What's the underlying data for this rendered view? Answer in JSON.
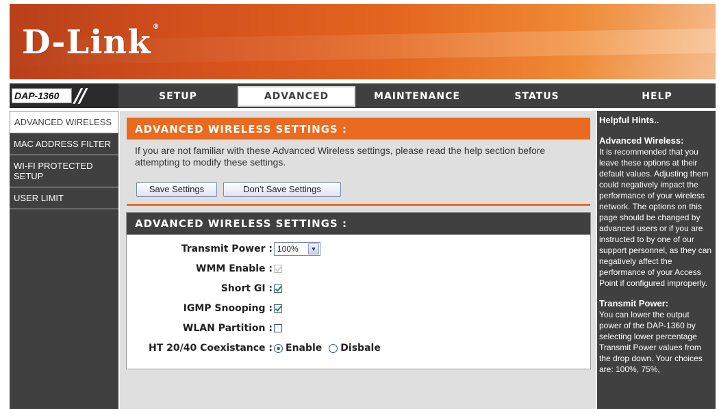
{
  "brand": {
    "logo": "D-Link",
    "reg": "®"
  },
  "nav": {
    "model": "DAP-1360",
    "tabs": [
      "SETUP",
      "ADVANCED",
      "MAINTENANCE",
      "STATUS",
      "HELP"
    ],
    "active_tab": "ADVANCED"
  },
  "sidebar": {
    "items": [
      {
        "label": "ADVANCED WIRELESS",
        "active": true
      },
      {
        "label": "MAC ADDRESS FILTER",
        "active": false
      },
      {
        "label": "WI-FI PROTECTED SETUP",
        "active": false
      },
      {
        "label": "USER LIMIT",
        "active": false
      }
    ]
  },
  "intro": {
    "title": "ADVANCED WIRELESS SETTINGS :",
    "description": "If you are not familiar with these Advanced Wireless settings, please read the help section before attempting to modify these settings.",
    "save_label": "Save Settings",
    "dont_save_label": "Don't Save Settings"
  },
  "settings": {
    "title": "ADVANCED WIRELESS SETTINGS :",
    "transmit_power": {
      "label": "Transmit Power :",
      "value": "100%"
    },
    "wmm_enable": {
      "label": "WMM Enable :",
      "checked": true,
      "disabled": true
    },
    "short_gi": {
      "label": "Short GI :",
      "checked": true
    },
    "igmp_snooping": {
      "label": "IGMP Snooping :",
      "checked": true
    },
    "wlan_partition": {
      "label": "WLAN Partition :",
      "checked": false
    },
    "ht_coexistance": {
      "label": "HT 20/40 Coexistance :",
      "enable_label": "Enable",
      "disable_label": "Disbale",
      "selected": "Enable"
    }
  },
  "help": {
    "title": "Helpful Hints..",
    "section1_title": "Advanced Wireless:",
    "section1_text": "It is recommended that you leave these options at their default values. Adjusting them could negatively impact the performance of your wireless network. The options on this page should be changed by advanced users or if you are instructed to by one of our support personnel, as they can negatively affect the performance of your Access Point if configured improperly.",
    "section2_title": "Transmit Power:",
    "section2_text": "You can lower the output power of the DAP-1360 by selecting lower percentage Transmit Power values from the drop down. Your choices are: 100%, 75%,"
  },
  "colors": {
    "accent": "#ea6b1f",
    "dark": "#404040",
    "panel": "#dfdfdf"
  }
}
